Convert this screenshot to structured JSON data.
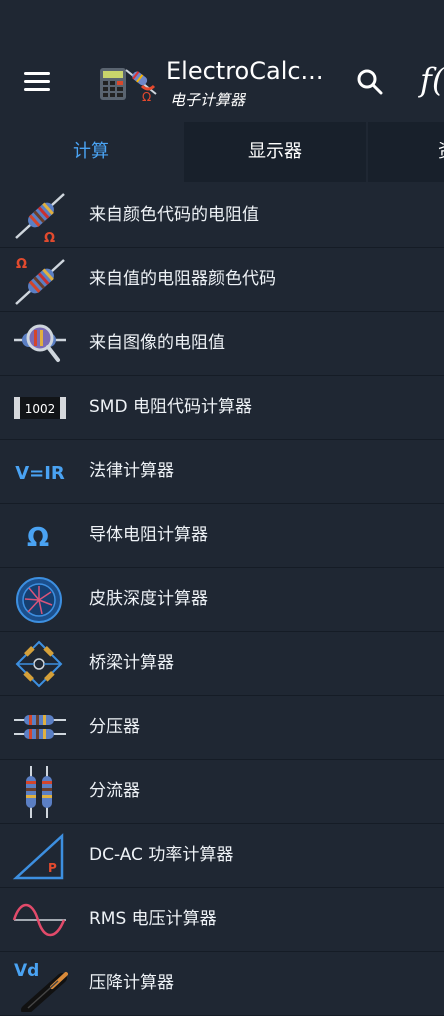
{
  "header": {
    "title": "ElectroCalc...",
    "subtitle": "电子计算器",
    "menu_icon": "hamburger-menu-icon",
    "search_icon": "search-icon",
    "fx_label": "f(",
    "accent": "#4aa3f3"
  },
  "tabs": [
    {
      "label": "计算",
      "active": true
    },
    {
      "label": "显示器",
      "active": false
    },
    {
      "label": "资",
      "active": false
    }
  ],
  "items": [
    {
      "label": "来自颜色代码的电阻值",
      "icon": "resistor-ohm-icon"
    },
    {
      "label": "来自值的电阻器颜色代码",
      "icon": "ohm-resistor-icon"
    },
    {
      "label": "来自图像的电阻值",
      "icon": "resistor-magnifier-icon"
    },
    {
      "label": "SMD 电阻代码计算器",
      "icon": "smd-resistor-icon",
      "icon_text": "1002"
    },
    {
      "label": "法律计算器",
      "icon": "ohms-law-icon",
      "icon_text": "V=IR"
    },
    {
      "label": "导体电阻计算器",
      "icon": "omega-icon",
      "icon_text": "Ω"
    },
    {
      "label": "皮肤深度计算器",
      "icon": "skin-depth-icon"
    },
    {
      "label": "桥梁计算器",
      "icon": "bridge-circuit-icon"
    },
    {
      "label": "分压器",
      "icon": "voltage-divider-icon"
    },
    {
      "label": "分流器",
      "icon": "current-divider-icon"
    },
    {
      "label": "DC-AC 功率计算器",
      "icon": "power-triangle-icon",
      "icon_text": "P"
    },
    {
      "label": "RMS 电压计算器",
      "icon": "sine-wave-icon"
    },
    {
      "label": "压降计算器",
      "icon": "voltage-drop-cable-icon",
      "icon_text": "Vd"
    }
  ]
}
